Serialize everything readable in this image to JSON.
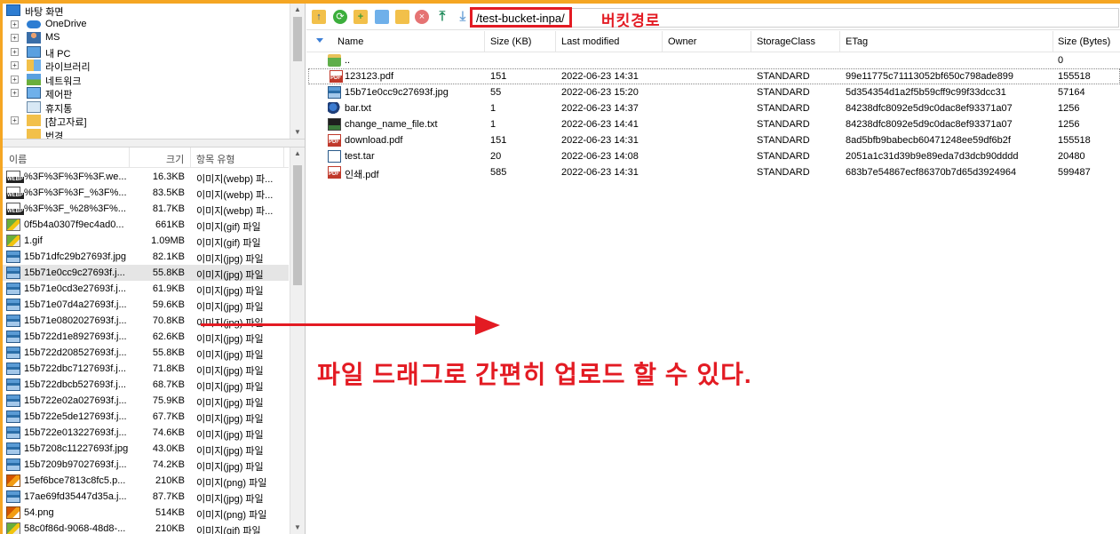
{
  "tree": {
    "items": [
      {
        "label": "바탕 화면",
        "indent": 0,
        "expander": "",
        "icon": "desktop-icon"
      },
      {
        "label": "OneDrive",
        "indent": 1,
        "expander": "+",
        "icon": "cloud-icon"
      },
      {
        "label": "MS",
        "indent": 1,
        "expander": "+",
        "icon": "user-icon"
      },
      {
        "label": "내 PC",
        "indent": 1,
        "expander": "+",
        "icon": "computer-icon"
      },
      {
        "label": "라이브러리",
        "indent": 1,
        "expander": "+",
        "icon": "library-icon"
      },
      {
        "label": "네트워크",
        "indent": 1,
        "expander": "+",
        "icon": "network-icon"
      },
      {
        "label": "제어판",
        "indent": 1,
        "expander": "+",
        "icon": "control-panel-icon"
      },
      {
        "label": "휴지통",
        "indent": 1,
        "expander": "",
        "icon": "recycle-bin-icon"
      },
      {
        "label": "[참고자료]",
        "indent": 1,
        "expander": "+",
        "icon": "folder-icon"
      },
      {
        "label": "번경",
        "indent": 1,
        "expander": "",
        "icon": "folder-icon"
      }
    ]
  },
  "local_list": {
    "headers": {
      "name": "이름",
      "size": "크기",
      "type": "항목 유형"
    },
    "rows": [
      {
        "name": "%3F%3F%3F%3F.we...",
        "size": "16.3KB",
        "type": "이미지(webp) 파...",
        "icon": "webp"
      },
      {
        "name": "%3F%3F%3F_%3F%...",
        "size": "83.5KB",
        "type": "이미지(webp) 파...",
        "icon": "webp"
      },
      {
        "name": "%3F%3F_%28%3F%...",
        "size": "81.7KB",
        "type": "이미지(webp) 파...",
        "icon": "webp"
      },
      {
        "name": "0f5b4a0307f9ec4ad0...",
        "size": "661KB",
        "type": "이미지(gif) 파일",
        "icon": "gif"
      },
      {
        "name": "1.gif",
        "size": "1.09MB",
        "type": "이미지(gif) 파일",
        "icon": "gif"
      },
      {
        "name": "15b71dfc29b27693f.jpg",
        "size": "82.1KB",
        "type": "이미지(jpg) 파일",
        "icon": "jpg"
      },
      {
        "name": "15b71e0cc9c27693f.j...",
        "size": "55.8KB",
        "type": "이미지(jpg) 파일",
        "icon": "jpg",
        "selected": true
      },
      {
        "name": "15b71e0cd3e27693f.j...",
        "size": "61.9KB",
        "type": "이미지(jpg) 파일",
        "icon": "jpg"
      },
      {
        "name": "15b71e07d4a27693f.j...",
        "size": "59.6KB",
        "type": "이미지(jpg) 파일",
        "icon": "jpg"
      },
      {
        "name": "15b71e0802027693f.j...",
        "size": "70.8KB",
        "type": "이미지(jpg) 파일",
        "icon": "jpg"
      },
      {
        "name": "15b722d1e8927693f.j...",
        "size": "62.6KB",
        "type": "이미지(jpg) 파일",
        "icon": "jpg"
      },
      {
        "name": "15b722d208527693f.j...",
        "size": "55.8KB",
        "type": "이미지(jpg) 파일",
        "icon": "jpg"
      },
      {
        "name": "15b722dbc7127693f.j...",
        "size": "71.8KB",
        "type": "이미지(jpg) 파일",
        "icon": "jpg"
      },
      {
        "name": "15b722dbcb527693f.j...",
        "size": "68.7KB",
        "type": "이미지(jpg) 파일",
        "icon": "jpg"
      },
      {
        "name": "15b722e02a027693f.j...",
        "size": "75.9KB",
        "type": "이미지(jpg) 파일",
        "icon": "jpg"
      },
      {
        "name": "15b722e5de127693f.j...",
        "size": "67.7KB",
        "type": "이미지(jpg) 파일",
        "icon": "jpg"
      },
      {
        "name": "15b722e013227693f.j...",
        "size": "74.6KB",
        "type": "이미지(jpg) 파일",
        "icon": "jpg"
      },
      {
        "name": "15b7208c11227693f.jpg",
        "size": "43.0KB",
        "type": "이미지(jpg) 파일",
        "icon": "jpg"
      },
      {
        "name": "15b7209b97027693f.j...",
        "size": "74.2KB",
        "type": "이미지(jpg) 파일",
        "icon": "jpg"
      },
      {
        "name": "15ef6bce7813c8fc5.p...",
        "size": "210KB",
        "type": "이미지(png) 파일",
        "icon": "png"
      },
      {
        "name": "17ae69fd35447d35a.j...",
        "size": "87.7KB",
        "type": "이미지(jpg) 파일",
        "icon": "jpg"
      },
      {
        "name": "54.png",
        "size": "514KB",
        "type": "이미지(png) 파일",
        "icon": "png"
      },
      {
        "name": "58c0f86d-9068-48d8-...",
        "size": "210KB",
        "type": "이미지(gif) 파일",
        "icon": "gif"
      }
    ]
  },
  "toolbar": {
    "buttons": [
      "back-icon",
      "refresh-icon",
      "new-folder-icon",
      "new-file-icon",
      "folder-icon",
      "delete-icon",
      "upload-icon",
      "download-icon"
    ],
    "path": "/test-bucket-inpa/",
    "path_caption": "버킷경로"
  },
  "remote_list": {
    "headers": {
      "name": "Name",
      "size": "Size (KB)",
      "modified": "Last modified",
      "owner": "Owner",
      "storage": "StorageClass",
      "etag": "ETag",
      "bytes": "Size (Bytes)"
    },
    "rows": [
      {
        "name": "..",
        "size": "",
        "modified": "",
        "owner": "",
        "storage": "",
        "etag": "",
        "bytes": "0",
        "icon": "folder-up"
      },
      {
        "name": "123123.pdf",
        "size": "151",
        "modified": "2022-06-23 14:31",
        "owner": "",
        "storage": "STANDARD",
        "etag": "99e11775c71113052bf650c798ade899",
        "bytes": "155518",
        "icon": "pdf",
        "focus": true
      },
      {
        "name": "15b71e0cc9c27693f.jpg",
        "size": "55",
        "modified": "2022-06-23 15:20",
        "owner": "",
        "storage": "STANDARD",
        "etag": "5d354354d1a2f5b59cff9c99f33dcc31",
        "bytes": "57164",
        "icon": "jpg"
      },
      {
        "name": "bar.txt",
        "size": "1",
        "modified": "2022-06-23 14:37",
        "owner": "",
        "storage": "STANDARD",
        "etag": "84238dfc8092e5d9c0dac8ef93371a07",
        "bytes": "1256",
        "icon": "bar"
      },
      {
        "name": "change_name_file.txt",
        "size": "1",
        "modified": "2022-06-23 14:41",
        "owner": "",
        "storage": "STANDARD",
        "etag": "84238dfc8092e5d9c0dac8ef93371a07",
        "bytes": "1256",
        "icon": "py"
      },
      {
        "name": "download.pdf",
        "size": "151",
        "modified": "2022-06-23 14:31",
        "owner": "",
        "storage": "STANDARD",
        "etag": "8ad5bfb9babecb60471248ee59df6b2f",
        "bytes": "155518",
        "icon": "pdf"
      },
      {
        "name": "test.tar",
        "size": "20",
        "modified": "2022-06-23 14:08",
        "owner": "",
        "storage": "STANDARD",
        "etag": "2051a1c31d39b9e89eda7d3dcb90dddd",
        "bytes": "20480",
        "icon": "tar"
      },
      {
        "name": "인쇄.pdf",
        "size": "585",
        "modified": "2022-06-23 14:31",
        "owner": "",
        "storage": "STANDARD",
        "etag": "683b7e54867ecf86370b7d65d3924964",
        "bytes": "599487",
        "icon": "pdf"
      }
    ]
  },
  "annotation": {
    "text": "파일 드래그로 간편히 업로드 할 수 있다."
  },
  "colors": {
    "accent_red": "#e31b23",
    "window_orange": "#f5a623"
  }
}
